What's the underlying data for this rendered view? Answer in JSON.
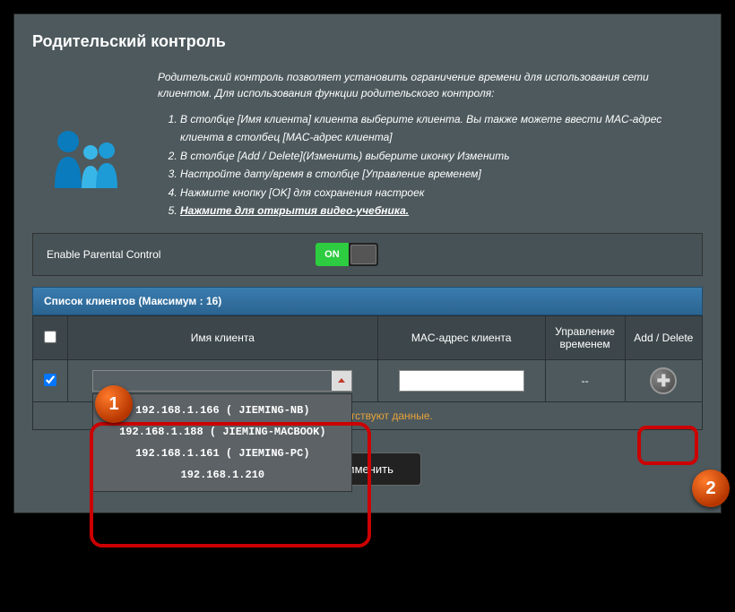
{
  "title": "Родительский контроль",
  "description": "Родительский контроль позволяет установить ограничение времени для использования сети клиентом. Для использования функции родительского контроля:",
  "steps": [
    "В столбце [Имя клиента] клиента выберите клиента. Вы также можете ввести MAC-адрес клиента в столбец [MAC-адрес клиента]",
    "В столбце [Add / Delete](Изменить) выберите иконку Изменить",
    "Настройте дату/время в столбце [Управление временем]",
    "Нажмите кнопку [OK] для сохранения настроек",
    "Нажмите для открытия видео-учебника."
  ],
  "enable": {
    "label": "Enable Parental Control",
    "value": "ON"
  },
  "list_header": "Список клиентов (Максимум : 16)",
  "columns": {
    "name": "Имя клиента",
    "mac": "MAC-адрес клиента",
    "time": "Управление временем",
    "action": "Add / Delete"
  },
  "row": {
    "checked": true,
    "name_value": "",
    "mac_value": "",
    "time_text": "--"
  },
  "dropdown_items": [
    "192.168.1.166 ( JIEMING-NB)",
    "192.168.1.188 ( JIEMING-MACBOOK)",
    "192.168.1.161 ( JIEMING-PC)",
    "192.168.1.210"
  ],
  "empty_text": "пице отсутствуют данные.",
  "apply_label": "рименить",
  "annotations": {
    "badge1": "1",
    "badge2": "2"
  }
}
